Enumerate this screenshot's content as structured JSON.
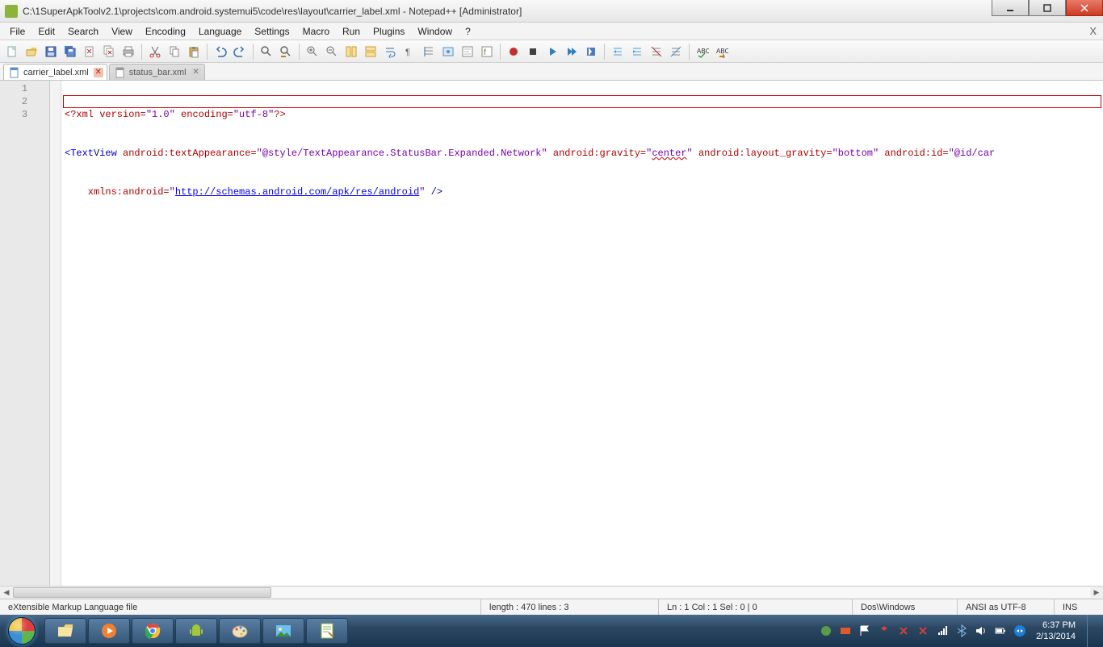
{
  "window": {
    "title": "C:\\1SuperApkToolv2.1\\projects\\com.android.systemui5\\code\\res\\layout\\carrier_label.xml - Notepad++ [Administrator]"
  },
  "menu": {
    "file": "File",
    "edit": "Edit",
    "search": "Search",
    "view": "View",
    "encoding": "Encoding",
    "language": "Language",
    "settings": "Settings",
    "macro": "Macro",
    "run": "Run",
    "plugins": "Plugins",
    "window": "Window",
    "help": "?",
    "closeX": "X"
  },
  "tabs": {
    "t0": "carrier_label.xml",
    "t1": "status_bar.xml"
  },
  "lines": {
    "l1": "1",
    "l2": "2",
    "l3": "3"
  },
  "code": {
    "l1": {
      "a": "<?xml version=",
      "b": "\"1.0\"",
      "c": " encoding=",
      "d": "\"utf-8\"",
      "e": "?>"
    },
    "l2": {
      "a": "<TextView",
      "b": " android:textAppearance=",
      "c": "\"@style/TextAppearance.StatusBar.Expanded.Network\"",
      "d": " android:gravity=",
      "e_open": "\"",
      "e_word": "center",
      "e_close": "\"",
      "f": " android:layout_gravity=",
      "g": "\"bottom\"",
      "h": " android:id=",
      "i": "\"@id/car"
    },
    "l3": {
      "a": "    xmlns:android=",
      "b_open": "\"",
      "b_url": "http://schemas.android.com/apk/res/android",
      "b_close": "\"",
      "c": " />"
    }
  },
  "status": {
    "lang": "eXtensible Markup Language file",
    "len": "length : 470    lines : 3",
    "pos": "Ln : 1    Col : 1    Sel : 0 | 0",
    "eol": "Dos\\Windows",
    "enc": "ANSI as UTF-8",
    "ovr": "INS"
  },
  "tray": {
    "time": "6:37 PM",
    "date": "2/13/2014"
  }
}
